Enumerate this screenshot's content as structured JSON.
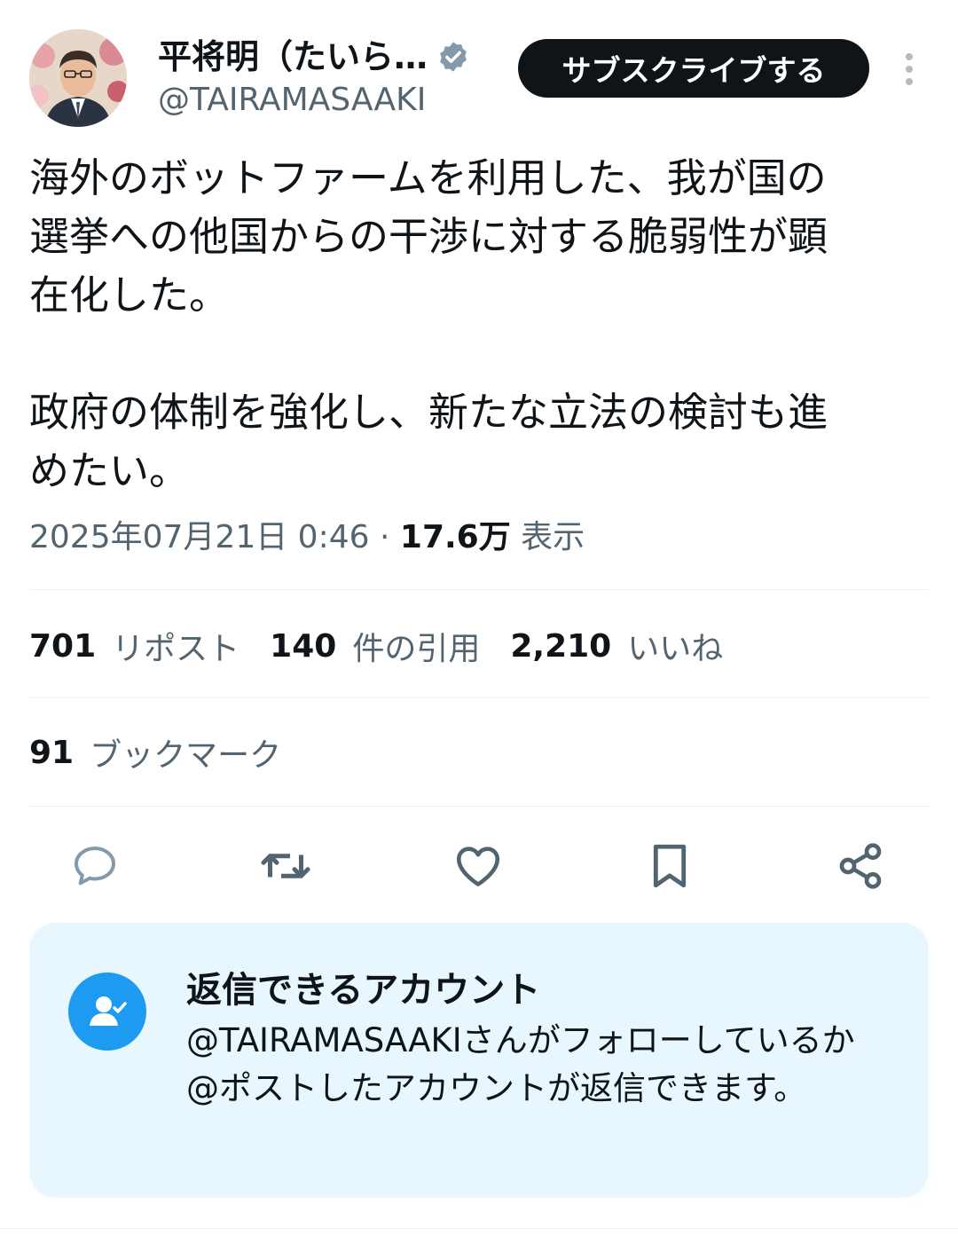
{
  "author": {
    "display_name": "平将明（たいら…",
    "handle": "@TAIRAMASAAKI",
    "verified": true
  },
  "subscribe_label": "サブスクライブする",
  "tweet": {
    "text": "海外のボットファームを利用した、我が国の\n選挙への他国からの干渉に対する脆弱性が顕\n在化した。\n\n政府の体制を強化し、新たな立法の検討も進\nめたい。"
  },
  "meta": {
    "timestamp": "2025年07月21日 0:46",
    "separator": "·",
    "views_count": "17.6万",
    "views_label": "表示"
  },
  "stats": [
    {
      "count": "701",
      "label": "リポスト"
    },
    {
      "count": "140",
      "label": "件の引用"
    },
    {
      "count": "2,210",
      "label": "いいね"
    }
  ],
  "bookmarks": {
    "count": "91",
    "label": "ブックマーク"
  },
  "actions": [
    "reply-icon",
    "retweet-icon",
    "like-icon",
    "bookmark-icon",
    "share-icon"
  ],
  "reply_restriction": {
    "title": "返信できるアカウント",
    "body": "@TAIRAMASAAKIさんがフォローしているか@ポストしたアカウントが返信できます。"
  },
  "colors": {
    "text_primary": "#0f1419",
    "text_secondary": "#536471",
    "accent": "#1d9bf0",
    "reply_box_bg": "#e8f6fd"
  }
}
